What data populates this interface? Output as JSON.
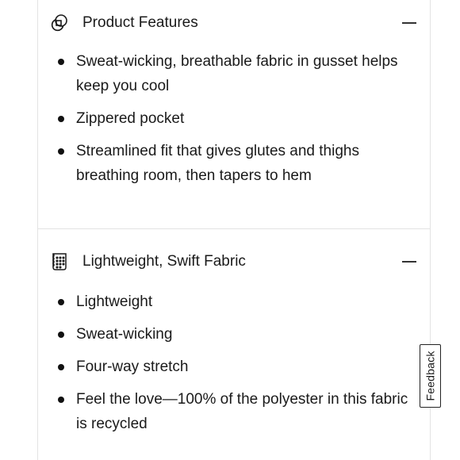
{
  "sections": [
    {
      "icon": "overlapping-circles-icon",
      "title": "Product Features",
      "expanded": true,
      "items": [
        "Sweat-wicking, breathable fabric in gusset helps keep you cool",
        "Zippered pocket",
        "Streamlined fit that gives glutes and thighs breathing room, then tapers to hem"
      ]
    },
    {
      "icon": "fabric-swatch-icon",
      "title": "Lightweight, Swift Fabric",
      "expanded": true,
      "items": [
        "Lightweight",
        "Sweat-wicking",
        "Four-way stretch",
        "Feel the love—100% of the polyester in this fabric is recycled"
      ]
    }
  ],
  "feedback": {
    "label": "Feedback"
  }
}
